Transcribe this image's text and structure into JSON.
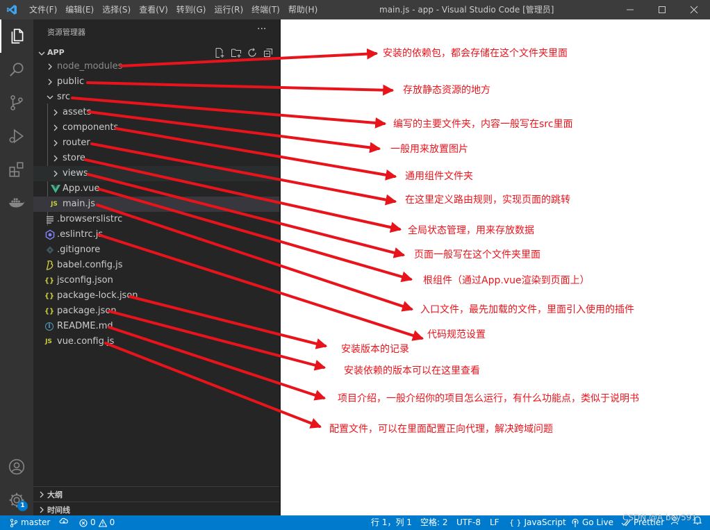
{
  "window": {
    "title": "main.js - app - Visual Studio Code [管理员]",
    "menu": [
      "文件(F)",
      "编辑(E)",
      "选择(S)",
      "查看(V)",
      "转到(G)",
      "运行(R)",
      "终端(T)",
      "帮助(H)"
    ]
  },
  "sidebar": {
    "title": "资源管理器",
    "more": "···",
    "section": "APP",
    "tree": [
      {
        "name": "node_modules",
        "type": "folder",
        "icon": "chevron-right-icon"
      },
      {
        "name": "public",
        "type": "folder",
        "icon": "chevron-right-icon"
      },
      {
        "name": "src",
        "type": "folder-open",
        "icon": "chevron-down-icon"
      },
      {
        "name": "assets",
        "type": "folder",
        "icon": "chevron-right-icon"
      },
      {
        "name": "components",
        "type": "folder",
        "icon": "chevron-right-icon"
      },
      {
        "name": "router",
        "type": "folder",
        "icon": "chevron-right-icon"
      },
      {
        "name": "store",
        "type": "folder",
        "icon": "chevron-right-icon"
      },
      {
        "name": "views",
        "type": "folder",
        "icon": "chevron-right-icon"
      },
      {
        "name": "App.vue",
        "type": "file",
        "icon": "vue-icon"
      },
      {
        "name": "main.js",
        "type": "file",
        "icon": "js-icon",
        "icon_text": "JS"
      },
      {
        "name": ".browserslistrc",
        "type": "file",
        "icon": "lines-icon"
      },
      {
        "name": ".eslintrc.js",
        "type": "file",
        "icon": "eslint-icon"
      },
      {
        "name": ".gitignore",
        "type": "file",
        "icon": "git-icon"
      },
      {
        "name": "babel.config.js",
        "type": "file",
        "icon": "babel-icon"
      },
      {
        "name": "jsconfig.json",
        "type": "file",
        "icon": "json-icon",
        "icon_text": "{}"
      },
      {
        "name": "package-lock.json",
        "type": "file",
        "icon": "json-icon",
        "icon_text": "{}"
      },
      {
        "name": "package.json",
        "type": "file",
        "icon": "json-icon",
        "icon_text": "{}"
      },
      {
        "name": "README.md",
        "type": "file",
        "icon": "info-icon",
        "icon_text": "i"
      },
      {
        "name": "vue.config.js",
        "type": "file",
        "icon": "js-icon",
        "icon_text": "JS"
      }
    ],
    "outline": "大纲",
    "timeline": "时间线"
  },
  "activity": {
    "badge": "1"
  },
  "statusbar": {
    "branch": "master",
    "errors": "0",
    "warnings": "0",
    "position": "行 1，列 1",
    "spaces": "空格: 2",
    "encoding": "UTF-8",
    "eol": "LF",
    "language": "JavaScript",
    "golive": "Go Live",
    "prettier": "Prettier"
  },
  "annotations": [
    "安装的依赖包，都会存储在这个文件夹里面",
    "存放静态资源的地方",
    "编写的主要文件夹，内容一般写在src里面",
    "一般用来放置图片",
    "通用组件文件夹",
    "在这里定义路由规则，实现页面的跳转",
    "全局状态管理，用来存放数据",
    "页面一般写在这个文件夹里面",
    "根组件（通过App.vue渲染到页面上）",
    "入口文件，最先加载的文件，里面引入使用的插件",
    "代码规范设置",
    "安装版本的记录",
    "安装依赖的版本可以在这里查看",
    "项目介绍，一般介绍你的项目怎么运行，有什么功能点，类似于说明书",
    "配置文件，可以在里面配置正向代理，解决跨域问题"
  ],
  "watermark": "CSDN @A boy591",
  "colors": {
    "accent": "#007acc",
    "annotation": "#e8141c"
  }
}
